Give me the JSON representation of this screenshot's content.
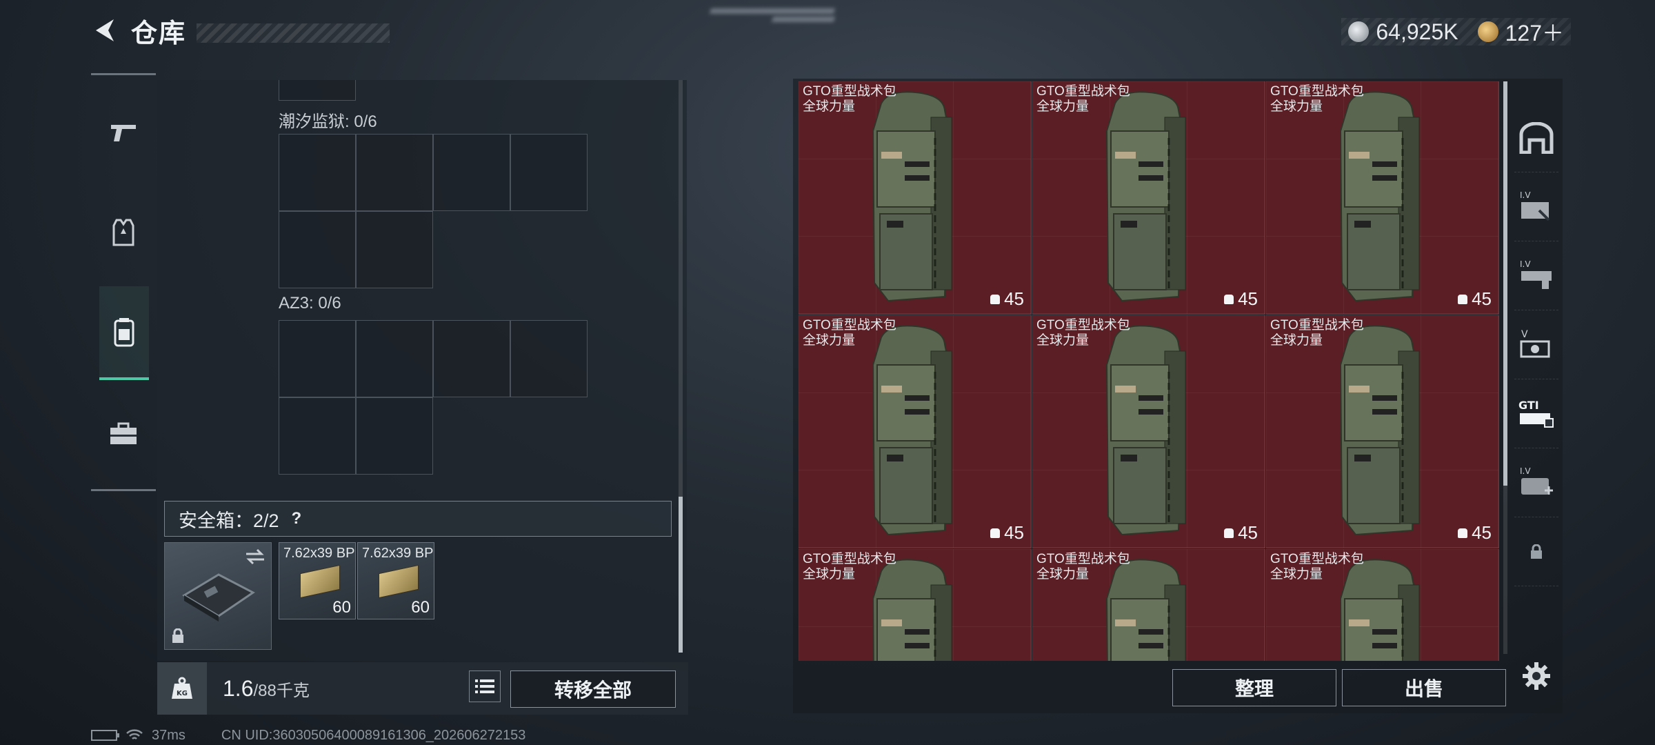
{
  "header": {
    "title": "仓库"
  },
  "currency": {
    "silver": "64,925K",
    "gold": "127＋"
  },
  "rail": {
    "items": [
      {
        "icon": "pistol-icon"
      },
      {
        "icon": "vest-icon"
      },
      {
        "icon": "backpack-icon",
        "active": true
      },
      {
        "icon": "toolbox-icon"
      }
    ]
  },
  "containers": {
    "tide_prison_label": "潮汐监狱: 0/6",
    "az3_label": "AZ3: 0/6"
  },
  "safebox": {
    "label": "安全箱：2/2",
    "help": "?",
    "ammo": [
      {
        "name": "7.62x39 BP",
        "count": "60"
      },
      {
        "name": "7.62x39 BP",
        "count": "60"
      }
    ]
  },
  "weight": {
    "current": "1.6",
    "max": "/88千克"
  },
  "buttons": {
    "transfer_all": "转移全部",
    "organize": "整理",
    "sell": "出售"
  },
  "items": [
    {
      "name": "GTO重型战术包",
      "tag": "全球力量",
      "count": "45"
    },
    {
      "name": "GTO重型战术包",
      "tag": "全球力量",
      "count": "45"
    },
    {
      "name": "GTO重型战术包",
      "tag": "全球力量",
      "count": "45"
    },
    {
      "name": "GTO重型战术包",
      "tag": "全球力量",
      "count": "45"
    },
    {
      "name": "GTO重型战术包",
      "tag": "全球力量",
      "count": "45"
    },
    {
      "name": "GTO重型战术包",
      "tag": "全球力量",
      "count": "45"
    },
    {
      "name": "GTO重型战术包",
      "tag": "全球力量",
      "count": ""
    },
    {
      "name": "GTO重型战术包",
      "tag": "全球力量",
      "count": ""
    },
    {
      "name": "GTO重型战术包",
      "tag": "全球力量",
      "count": ""
    }
  ],
  "status": {
    "ping": "37ms",
    "uid": "CN UID:3603050640008916130​6_202606272153"
  }
}
